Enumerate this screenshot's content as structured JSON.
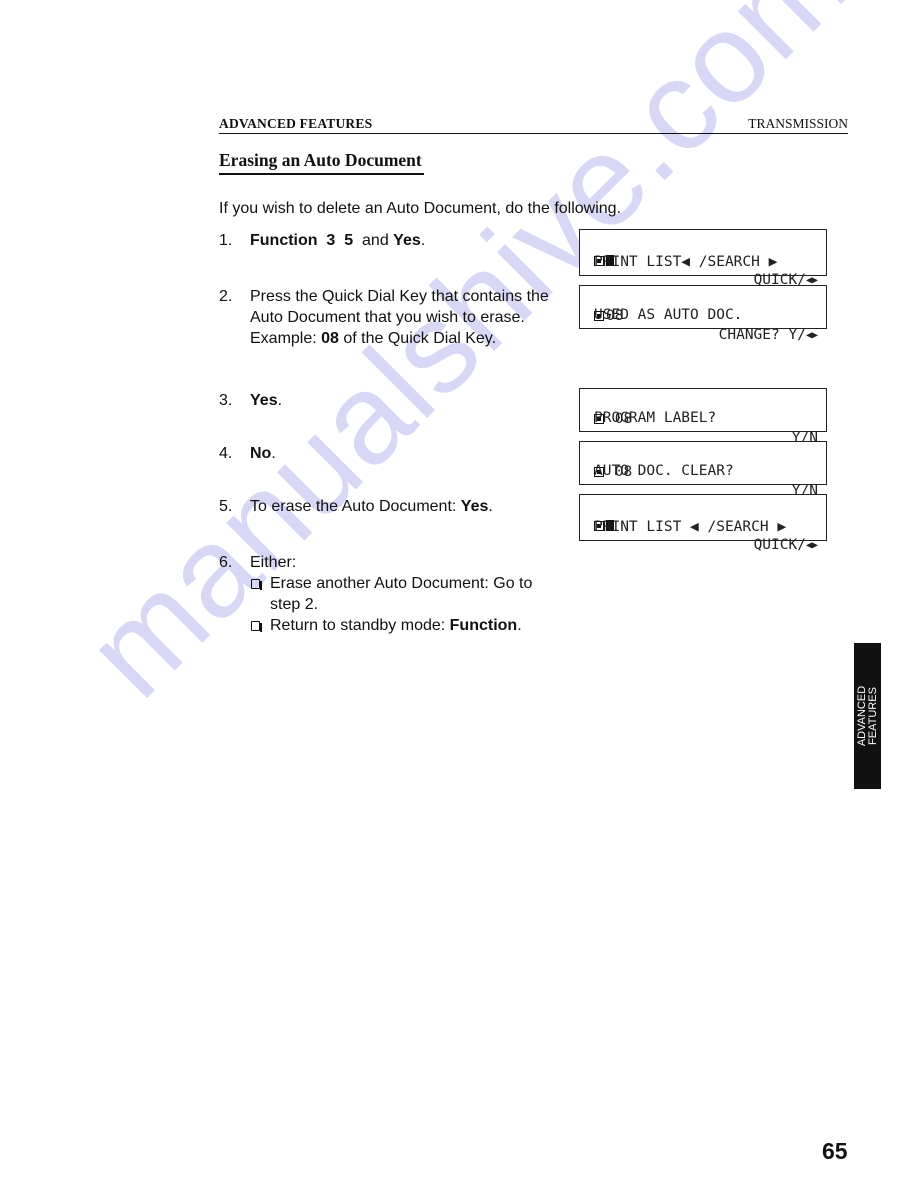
{
  "watermark": "manualshive.com",
  "header": {
    "section": "ADVANCED FEATURES",
    "chapter": "TRANSMISSION"
  },
  "title": "Erasing an Auto Document",
  "intro": "If you wish to delete an Auto Document, do the following.",
  "steps": [
    {
      "num": "1.",
      "parts": [
        {
          "text": "Function  3  5",
          "bold": true
        },
        {
          "text": "  and ",
          "bold": false
        },
        {
          "text": "Yes",
          "bold": true
        },
        {
          "text": ".",
          "bold": false
        }
      ]
    },
    {
      "num": "2.",
      "text": "Press the Quick Dial Key that contains the Auto Document that you wish to erase.",
      "example_prefix": "Example: ",
      "example_bold": "08",
      "example_suffix": " of the Quick Dial Key."
    },
    {
      "num": "3.",
      "bold": "Yes",
      "suffix": "."
    },
    {
      "num": "4.",
      "bold": "No",
      "suffix": "."
    },
    {
      "num": "5.",
      "prefix": "To erase the Auto Document: ",
      "bold": "Yes",
      "suffix": "."
    },
    {
      "num": "6.",
      "text": "Either:",
      "options": [
        {
          "prefix": "Erase another Auto Document: Go to step 2.",
          "bold": "",
          "suffix": ""
        },
        {
          "prefix": "Return to standby mode: ",
          "bold": "Function",
          "suffix": "."
        }
      ]
    }
  ],
  "lcd_displays": [
    {
      "icons": [
        "box-icon",
        "solid-block-icon"
      ],
      "line1_left": "",
      "line1_right": "QUICK/",
      "line1_arrows": "◀▶",
      "line2": "PRINT LIST◀ /SEARCH ▶"
    },
    {
      "icons": [
        "box-icon"
      ],
      "line1_left": "08",
      "line1_right": "CHANGE? Y/",
      "line1_arrows": "◀▶",
      "line2": "USED AS AUTO DOC."
    },
    {
      "icons": [
        "box-icon"
      ],
      "line1_left": " 08",
      "line1_right": "Y/N",
      "line1_arrows": "",
      "line2": "PROGRAM LABEL?"
    },
    {
      "icons": [
        "box-icon"
      ],
      "line1_left": " 08",
      "line1_right": "Y/N",
      "line1_arrows": "",
      "line2": "AUTO DOC. CLEAR?"
    },
    {
      "icons": [
        "box-icon",
        "solid-block-icon"
      ],
      "line1_left": "",
      "line1_right": "QUICK/",
      "line1_arrows": "◀▶",
      "line2": "PRINT LIST ◀ /SEARCH ▶"
    }
  ],
  "side_tab": {
    "line1": "ADVANCED",
    "line2": "FEATURES"
  },
  "page_number": "65"
}
